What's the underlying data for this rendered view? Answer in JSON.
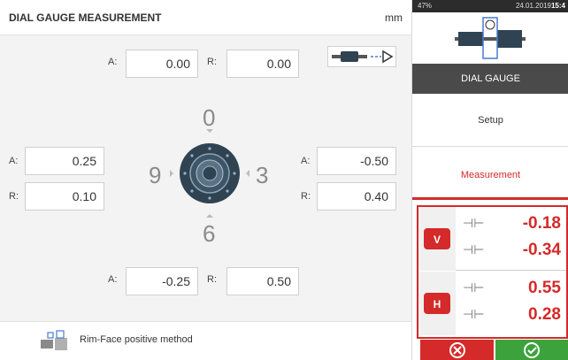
{
  "header": {
    "title": "DIAL GAUGE MEASUREMENT",
    "unit": "mm"
  },
  "top": {
    "a_label": "A:",
    "a_value": "0.00",
    "r_label": "R:",
    "r_value": "0.00"
  },
  "left": {
    "a_label": "A:",
    "a_value": "0.25",
    "r_label": "R:",
    "r_value": "0.10"
  },
  "right": {
    "a_label": "A:",
    "a_value": "-0.50",
    "r_label": "R:",
    "r_value": "0.40"
  },
  "bottom": {
    "a_label": "A:",
    "a_value": "-0.25",
    "r_label": "R:",
    "r_value": "0.50"
  },
  "positions": {
    "top": "0",
    "left": "9",
    "right": "3",
    "bottom": "6"
  },
  "footer": {
    "method": "Rim-Face positive method"
  },
  "status": {
    "battery": "47%",
    "date": "24.01.2019",
    "time": "15:4"
  },
  "sidebar": {
    "mode": "DIAL GAUGE",
    "setup": "Setup",
    "measurement": "Measurement"
  },
  "results": {
    "vertical": {
      "label": "V",
      "angularity": "-0.18",
      "offset": "-0.34"
    },
    "horizontal": {
      "label": "H",
      "angularity": "0.55",
      "offset": "0.28"
    }
  },
  "colors": {
    "accent_red": "#d42a2a",
    "ok_green": "#3ca33c",
    "dark_bar": "#4a4a4a",
    "coupling_dark": "#2f4353"
  }
}
